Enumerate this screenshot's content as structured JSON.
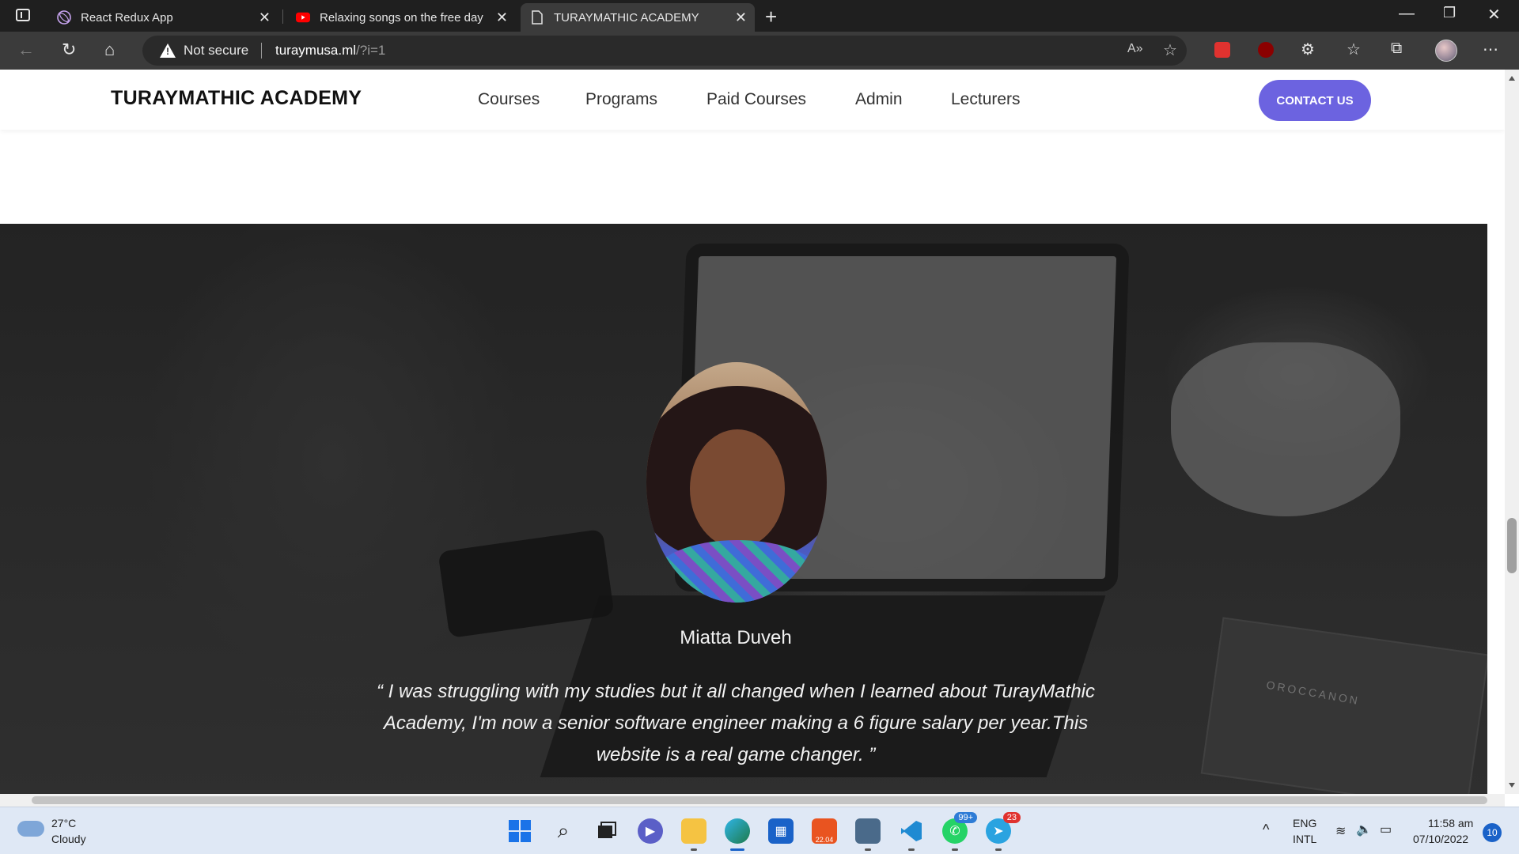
{
  "browser": {
    "tabs": [
      {
        "title": "React Redux App",
        "icon": "react-redux-icon"
      },
      {
        "title": "Relaxing songs on the free day -",
        "icon": "youtube-icon"
      },
      {
        "title": "TURAYMATHIC ACADEMY",
        "icon": "page-icon"
      }
    ],
    "address_bar": {
      "security": "Not secure",
      "host": "turaymusa.ml",
      "path": "/?i=1"
    }
  },
  "site": {
    "brand": "TURAYMATHIC ACADEMY",
    "nav": [
      "Courses",
      "Programs",
      "Paid Courses",
      "Admin",
      "Lecturers"
    ],
    "contact_button": "CONTACT US",
    "accent_color": "#6c63e0"
  },
  "testimonial": {
    "name": "Miatta Duveh",
    "quote": "“ I was struggling with my studies but it all changed when I learned about TurayMathic Academy, I'm now a senior software engineer making a 6 figure salary per year.This website is a real game changer. ”",
    "background_notebook_text": "OROCCANON"
  },
  "taskbar": {
    "weather_temp": "27°C",
    "weather_condition": "Cloudy",
    "whatsapp_badge": "99+",
    "telegram_badge": "23",
    "ubuntu_label": "22.04",
    "language": "ENG",
    "layout": "INTL",
    "time": "11:58 am",
    "date": "07/10/2022",
    "notifications": "10"
  }
}
